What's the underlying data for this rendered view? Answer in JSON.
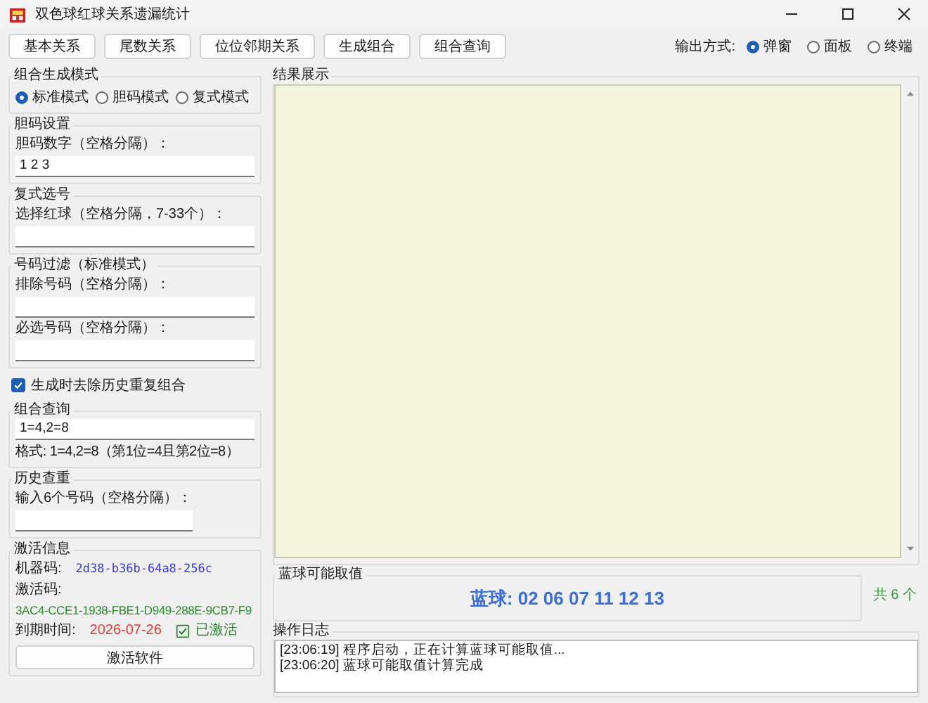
{
  "window": {
    "title": "双色球红球关系遗漏统计"
  },
  "toolbar": {
    "buttons": [
      "基本关系",
      "尾数关系",
      "位位邻期关系",
      "生成组合",
      "组合查询"
    ]
  },
  "output_mode": {
    "label": "输出方式:",
    "options": [
      {
        "label": "弹窗",
        "selected": true
      },
      {
        "label": "面板",
        "selected": false
      },
      {
        "label": "终端",
        "selected": false
      }
    ]
  },
  "generation_mode": {
    "title": "组合生成模式",
    "options": [
      {
        "label": "标准模式",
        "selected": true
      },
      {
        "label": "胆码模式",
        "selected": false
      },
      {
        "label": "复式模式",
        "selected": false
      }
    ]
  },
  "dan_settings": {
    "title": "胆码设置",
    "label": "胆码数字（空格分隔）：",
    "value": "1 2 3"
  },
  "compound": {
    "title": "复式选号",
    "label": "选择红球（空格分隔，7-33个）："
  },
  "filter": {
    "title": "号码过滤（标准模式）",
    "fields": [
      {
        "label": "排除号码（空格分隔）："
      },
      {
        "label": "必选号码（空格分隔）："
      }
    ]
  },
  "dedupe": {
    "label": "生成时去除历史重复组合",
    "checked": true
  },
  "query": {
    "title": "组合查询",
    "value": "1=4,2=8",
    "hint": "格式: 1=4,2=8（第1位=4且第2位=8）"
  },
  "history": {
    "title": "历史查重",
    "label": "输入6个号码（空格分隔）："
  },
  "activation": {
    "title": "激活信息",
    "machine_label": "机器码:",
    "machine_code": "2d38-b36b-64a8-256c",
    "code_label": "激活码:",
    "code": "3AC4-CCE1-1938-FBE1-D949-288E-9CB7-F9",
    "expiry_label": "到期时间:",
    "expiry": "2026-07-26",
    "activated": true,
    "status": "已激活",
    "button": "激活软件"
  },
  "results": {
    "title": "结果展示"
  },
  "blue": {
    "title": "蓝球可能取值",
    "value": "蓝球: 02 06 07 11 12 13",
    "count": "共 6 个"
  },
  "log": {
    "title": "操作日志",
    "lines": [
      "[23:06:19] 程序启动，正在计算蓝球可能取值...",
      "[23:06:20] 蓝球可能取值计算完成"
    ]
  }
}
